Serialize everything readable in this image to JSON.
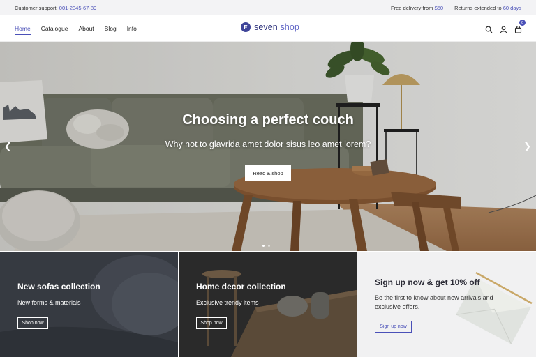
{
  "topbar": {
    "support_label": "Customer support:",
    "support_phone": "001-2345-67-89",
    "delivery_label": "Free delivery from",
    "delivery_value": "$50",
    "returns_label": "Returns extended to",
    "returns_value": "60 days"
  },
  "nav": {
    "items": [
      {
        "label": "Home",
        "active": true
      },
      {
        "label": "Catalogue"
      },
      {
        "label": "About"
      },
      {
        "label": "Blog"
      },
      {
        "label": "Info"
      }
    ]
  },
  "logo": {
    "mark": "E",
    "text_1": "seven",
    "text_2": "shop"
  },
  "header_icons": [
    "search-icon",
    "user-icon",
    "cart-icon"
  ],
  "cart": {
    "count": "0"
  },
  "hero": {
    "title": "Choosing a perfect couch",
    "subtitle": "Why not to glavrida amet dolor sisus leo amet lorem?",
    "button_label": "Read & shop",
    "prev_icon": "chevron-left-icon",
    "next_icon": "chevron-right-icon",
    "slides": 2,
    "active_slide": 1
  },
  "panels": [
    {
      "title": "New sofas collection",
      "subtitle": "New forms & materials",
      "button_label": "Shop now"
    },
    {
      "title": "Home decor collection",
      "subtitle": "Exclusive trendy items",
      "button_label": "Shop now"
    },
    {
      "title": "Sign up now & get 10% off",
      "subtitle": "Be the first to know about new arrivals and exclusive offers.",
      "button_label": "Sign up now"
    }
  ],
  "colors": {
    "accent": "#4a50b8",
    "brand": "#3f4599",
    "hero_text": "#ffffff"
  }
}
